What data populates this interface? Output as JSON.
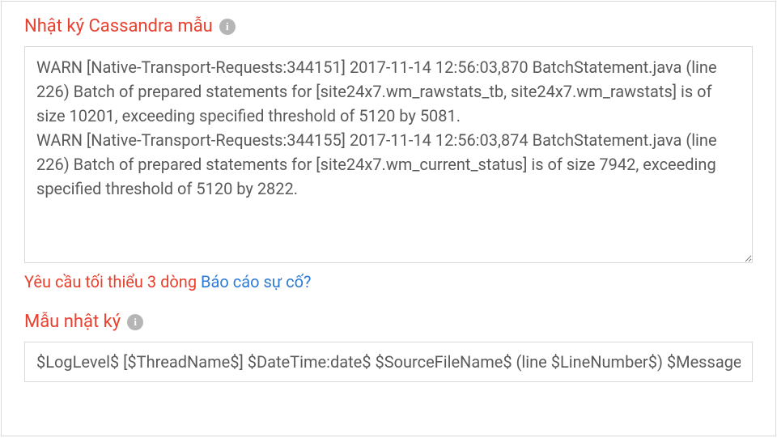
{
  "sample_log": {
    "label": "Nhật ký Cassandra mẫu",
    "info_glyph": "i",
    "value": "WARN [Native-Transport-Requests:344151] 2017-11-14 12:56:03,870 BatchStatement.java (line 226) Batch of prepared statements for [site24x7.wm_rawstats_tb, site24x7.wm_rawstats] is of size 10201, exceeding specified threshold of 5120 by 5081.\nWARN [Native-Transport-Requests:344155] 2017-11-14 12:56:03,874 BatchStatement.java (line 226) Batch of prepared statements for [site24x7.wm_current_status] is of size 7942, exceeding specified threshold of 5120 by 2822.",
    "hint": "Yêu cầu tối thiểu 3 dòng",
    "report_link": "Báo cáo sự cố?"
  },
  "pattern": {
    "label": "Mẫu nhật ký",
    "info_glyph": "i",
    "value": "$LogLevel$ [$ThreadName$] $DateTime:date$ $SourceFileName$ (line $LineNumber$) $Message$"
  }
}
